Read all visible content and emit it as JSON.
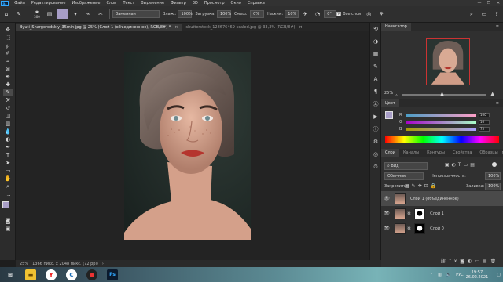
{
  "app": {
    "logo": "Ps"
  },
  "menu": [
    "Файл",
    "Редактирование",
    "Изображение",
    "Слои",
    "Текст",
    "Выделение",
    "Фильтр",
    "3D",
    "Просмотр",
    "Окно",
    "Справка"
  ],
  "window_controls": [
    "—",
    "❐",
    "✕"
  ],
  "options": {
    "brush_size": "300",
    "blend_mode": "Заменная",
    "opacity_label": "Влаж.:",
    "opacity_value": "100%",
    "flow_label": "Загрузка:",
    "flow_value": "100%",
    "mix_label": "Смеш.:",
    "mix_value": "0%",
    "pressure_label": "Нажим:",
    "pressure_value": "10%",
    "angle_value": "0°",
    "sample_all_label": "Все слои",
    "accent_color": "#a89ec7"
  },
  "tabs": [
    {
      "label": "Byuti_Shargorodskiy_35min.jpg @ 25% (Слой 1 (объединенное), RGB/8#) *",
      "active": true
    },
    {
      "label": "shutterstock_128676469-scaled.jpg @ 33,3% (RGB/8#)",
      "active": false
    }
  ],
  "status": {
    "zoom": "25%",
    "doc_size": "1366 пикс. x 2048 пикс. (72 ppi)"
  },
  "navigator": {
    "title": "Навигатор",
    "zoom": "25%"
  },
  "color_panel": {
    "title": "Цвет",
    "r": "160",
    "g": "16",
    "b": "75"
  },
  "layers_panel": {
    "tabs": [
      "Слои",
      "Каналы",
      "Контуры",
      "Свойства",
      "Образцы"
    ],
    "filter_label": "Вид",
    "blend_mode": "Обычные",
    "opacity_label": "Непрозрачность:",
    "opacity_value": "100%",
    "lock_label": "Закрепить:",
    "fill_label": "Заливка:",
    "fill_value": "100%",
    "layers": [
      {
        "name": "Слой 1 (объединенное)",
        "selected": true
      },
      {
        "name": "Слой 1",
        "selected": false
      },
      {
        "name": "Слой 0",
        "selected": false
      }
    ]
  },
  "taskbar": {
    "lang": "РУС",
    "time": "19:57",
    "date": "26.02.2021"
  }
}
